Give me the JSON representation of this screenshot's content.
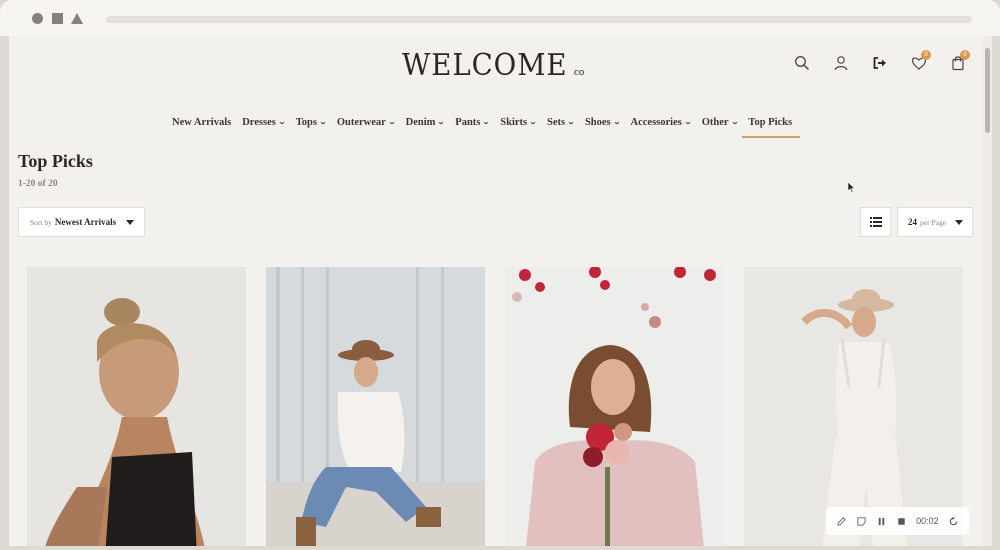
{
  "brand": {
    "logo_text": "WELCOME",
    "logo_suffix": "co"
  },
  "header_icons": [
    {
      "name": "search-icon"
    },
    {
      "name": "account-icon"
    },
    {
      "name": "logout-icon"
    },
    {
      "name": "wishlist-icon",
      "badge": "0"
    },
    {
      "name": "cart-icon",
      "badge": "0"
    }
  ],
  "nav": {
    "items": [
      {
        "label": "New Arrivals",
        "has_menu": false
      },
      {
        "label": "Dresses",
        "has_menu": true
      },
      {
        "label": "Tops",
        "has_menu": true
      },
      {
        "label": "Outerwear",
        "has_menu": true
      },
      {
        "label": "Denim",
        "has_menu": true
      },
      {
        "label": "Pants",
        "has_menu": true
      },
      {
        "label": "Skirts",
        "has_menu": true
      },
      {
        "label": "Sets",
        "has_menu": true
      },
      {
        "label": "Shoes",
        "has_menu": true
      },
      {
        "label": "Accessories",
        "has_menu": true
      },
      {
        "label": "Other",
        "has_menu": true
      },
      {
        "label": "Top Picks",
        "has_menu": false,
        "active": true
      }
    ]
  },
  "page": {
    "title": "Top Picks",
    "result_count": "1-20 of 20"
  },
  "toolbar": {
    "sort_label": "Sort by",
    "sort_value": "Newest Arrivals",
    "per_page_value": "24",
    "per_page_label": "per Page"
  },
  "player": {
    "time": "00:02"
  },
  "colors": {
    "accent": "#d3a06a",
    "badge": "#d99a4f",
    "page_bg": "#f3f1ee"
  }
}
